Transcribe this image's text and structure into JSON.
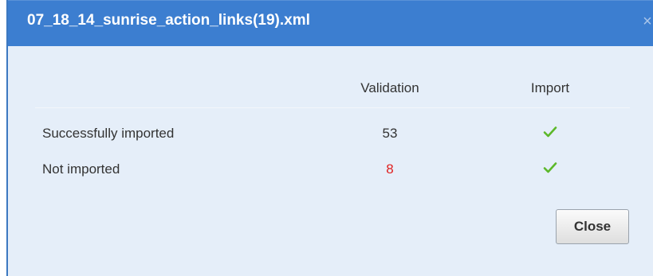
{
  "dialog": {
    "title": "07_18_14_sunrise_action_links(19).xml",
    "close_icon": "×"
  },
  "table": {
    "columns": [
      "Validation",
      "Import"
    ],
    "rows": [
      {
        "label": "Successfully imported",
        "validation": "53",
        "import_icon": "check-icon",
        "validation_color": "#333333"
      },
      {
        "label": "Not imported",
        "validation": "8",
        "import_icon": "check-icon",
        "validation_color": "#e02020"
      }
    ]
  },
  "footer": {
    "close_label": "Close"
  },
  "colors": {
    "header_bg": "#3c7ed0",
    "body_bg": "#e5eef9",
    "check_green": "#5cb82a",
    "error_red": "#e02020"
  }
}
